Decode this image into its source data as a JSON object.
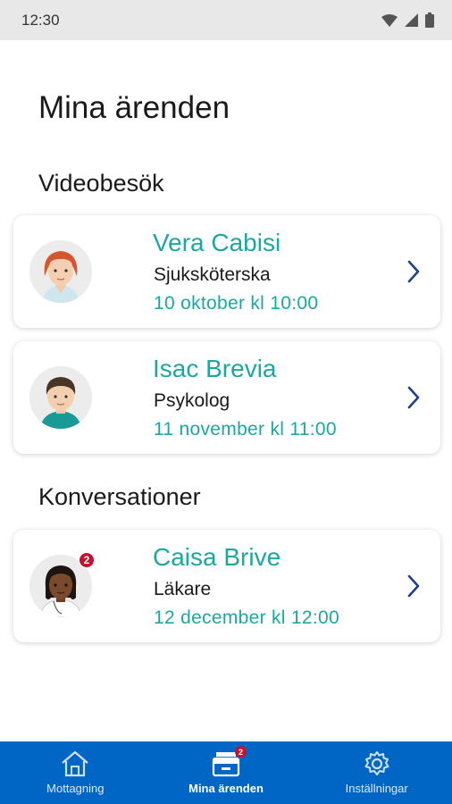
{
  "status_bar": {
    "time": "12:30"
  },
  "page": {
    "title": "Mina ärenden"
  },
  "sections": {
    "video": {
      "title": "Videobesök",
      "items": [
        {
          "name": "Vera Cabisi",
          "role": "Sjuksköterska",
          "time": "10 oktober kl 10:00",
          "avatar": "nurse-avatar-icon"
        },
        {
          "name": "Isac Brevia",
          "role": "Psykolog",
          "time": "11 november kl 11:00",
          "avatar": "psychologist-avatar-icon"
        }
      ]
    },
    "conversations": {
      "title": "Konversationer",
      "items": [
        {
          "name": "Caisa Brive",
          "role": "Läkare",
          "time": "12 december kl 12:00",
          "badge": "2",
          "avatar": "doctor-avatar-icon"
        }
      ]
    }
  },
  "bottom_nav": {
    "items": [
      {
        "label": "Mottagning",
        "icon": "home-icon"
      },
      {
        "label": "Mina ärenden",
        "icon": "inbox-icon",
        "badge": "2",
        "active": true
      },
      {
        "label": "Inställningar",
        "icon": "gear-icon"
      }
    ]
  },
  "colors": {
    "accent": "#1ba8a0",
    "nav_bg": "#0066c5",
    "badge": "#c8102e",
    "chevron": "#1f3f8f"
  }
}
